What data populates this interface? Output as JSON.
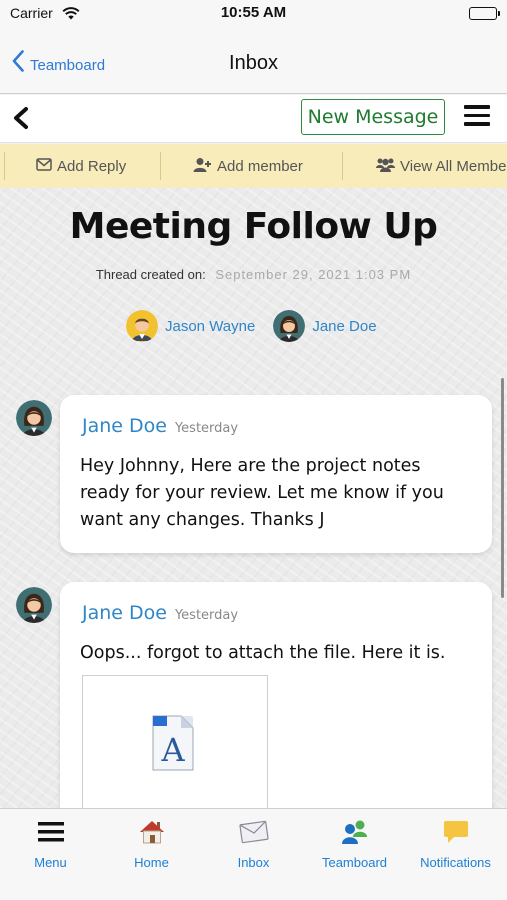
{
  "status_bar": {
    "carrier": "Carrier",
    "time": "10:55 AM"
  },
  "nav": {
    "back_label": "Teamboard",
    "title": "Inbox"
  },
  "toolbar": {
    "new_message_label": "New Message"
  },
  "actions": {
    "add_reply": "Add Reply",
    "add_member": "Add member",
    "view_all_members": "View All Members"
  },
  "thread": {
    "title": "Meeting Follow Up",
    "created_label": "Thread created on:",
    "created_value": "September 29, 2021 1:03 PM",
    "participants": [
      {
        "name": "Jason Wayne",
        "avatar": "male-avatar-icon"
      },
      {
        "name": "Jane Doe",
        "avatar": "female-avatar-icon"
      }
    ]
  },
  "messages": [
    {
      "author": "Jane Doe",
      "time": "Yesterday",
      "body": "Hey Johnny, Here are the project notes ready for your review. Let me know if you want any changes. Thanks J"
    },
    {
      "author": "Jane Doe",
      "time": "Yesterday",
      "body": "Oops... forgot to attach the file. Here it is.",
      "attachment_icon": "font-file-icon"
    }
  ],
  "tabs": [
    {
      "label": "Menu",
      "icon": "menu-icon"
    },
    {
      "label": "Home",
      "icon": "home-icon"
    },
    {
      "label": "Inbox",
      "icon": "envelope-icon"
    },
    {
      "label": "Teamboard",
      "icon": "team-icon"
    },
    {
      "label": "Notifications",
      "icon": "speech-bubble-icon"
    }
  ],
  "colors": {
    "accent_blue": "#2f86c8",
    "new_message_green": "#1e7b2f",
    "action_strip_bg": "#f8ecba",
    "tab_label_blue": "#1e7fd4"
  }
}
